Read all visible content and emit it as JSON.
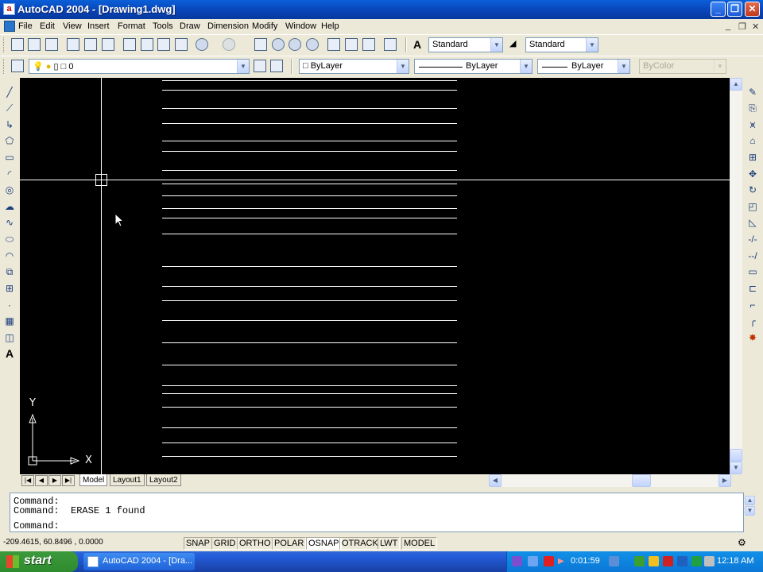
{
  "window": {
    "title": "AutoCAD 2004 - [Drawing1.dwg]",
    "app_icon_glyph": "a",
    "controls": [
      "_",
      "❐",
      "✕"
    ]
  },
  "menubar": {
    "items": [
      "File",
      "Edit",
      "View",
      "Insert",
      "Format",
      "Tools",
      "Draw",
      "Dimension",
      "Modify",
      "Window",
      "Help"
    ],
    "doc_controls": [
      "_",
      "❐",
      "✕"
    ]
  },
  "standard_toolbar": {
    "text_style": "Standard",
    "dim_style": "Standard"
  },
  "layers_toolbar": {
    "current_layer": "0"
  },
  "properties_toolbar": {
    "color": "ByLayer",
    "linetype": "ByLayer",
    "lineweight": "ByLayer",
    "plotstyle": "ByColor"
  },
  "draw_toolbar": {
    "icons": [
      "line-icon",
      "construction-line-icon",
      "polyline-icon",
      "polygon-icon",
      "rectangle-icon",
      "arc-icon",
      "circle-icon",
      "revision-cloud-icon",
      "spline-icon",
      "ellipse-icon",
      "ellipse-arc-icon",
      "insert-block-icon",
      "make-block-icon",
      "point-icon",
      "hatch-icon",
      "region-icon",
      "multiline-text-icon"
    ],
    "text_glyph": "A"
  },
  "modify_toolbar": {
    "icons": [
      "erase-icon",
      "copy-icon",
      "mirror-icon",
      "offset-icon",
      "array-icon",
      "move-icon",
      "rotate-icon",
      "scale-icon",
      "stretch-icon",
      "trim-icon",
      "extend-icon",
      "break-at-point-icon",
      "break-icon",
      "chamfer-icon",
      "fillet-icon",
      "explode-icon"
    ]
  },
  "ucs": {
    "x_label": "X",
    "y_label": "Y"
  },
  "tabs": {
    "model": "Model",
    "layout1": "Layout1",
    "layout2": "Layout2"
  },
  "command_window": {
    "lines": [
      "Command:",
      "Command:  ERASE 1 found",
      "Command:"
    ]
  },
  "status_bar": {
    "coordinates": "-209.4615, 60.8496 , 0.0000",
    "toggles": [
      "SNAP",
      "GRID",
      "ORTHO",
      "POLAR",
      "OSNAP",
      "OTRACK",
      "LWT",
      "MODEL"
    ]
  },
  "taskbar": {
    "start_label": "start",
    "task_button": "AutoCAD 2004 - [Dra...",
    "recorder_time": "0:01:59",
    "clock": "12:18 AM"
  },
  "colors": {
    "canvas_bg": "#000000",
    "canvas_line": "#ffffff",
    "title_bar": "#0842b5",
    "taskbar": "#245edb",
    "start_button": "#2e8b2e"
  }
}
